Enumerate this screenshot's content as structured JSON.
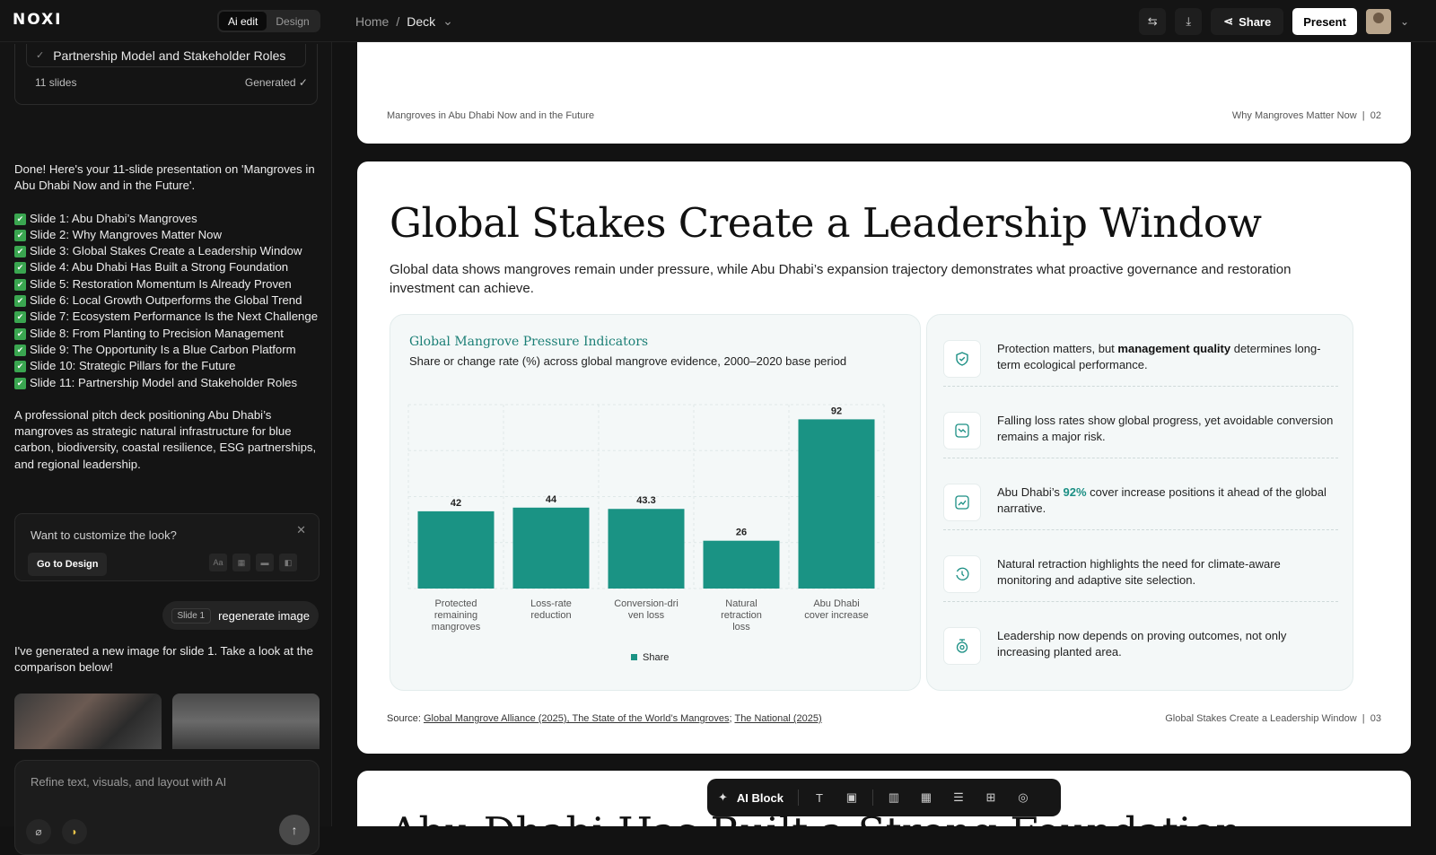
{
  "app": {
    "logo": "NOXI",
    "mode_ai": "Ai edit",
    "mode_design": "Design"
  },
  "breadcrumb": {
    "home": "Home",
    "sep": "/",
    "current": "Deck"
  },
  "toolbar_right": {
    "share": "Share",
    "present": "Present"
  },
  "outline": {
    "last_item": "Partnership Model and Stakeholder Roles",
    "count": "11 slides",
    "status": "Generated ✓"
  },
  "chat": {
    "intro": "Done! Here's your 11-slide presentation on 'Mangroves in Abu Dhabi Now and in the Future'.",
    "slides": [
      "Slide 1: Abu Dhabi’s Mangroves",
      "Slide 2: Why Mangroves Matter Now",
      "Slide 3: Global Stakes Create a Leadership Window",
      "Slide 4: Abu Dhabi Has Built a Strong Foundation",
      "Slide 5: Restoration Momentum Is Already Proven",
      "Slide 6: Local Growth Outperforms the Global Trend",
      "Slide 7: Ecosystem Performance Is the Next Challenge",
      "Slide 8: From Planting to Precision Management",
      "Slide 9: The Opportunity Is a Blue Carbon Platform",
      "Slide 10: Strategic Pillars for the Future",
      "Slide 11: Partnership Model and Stakeholder Roles"
    ],
    "summary": "A professional pitch deck positioning Abu Dhabi’s mangroves as strategic natural infrastructure for blue carbon, biodiversity, coastal resilience, ESG partnerships, and regional leadership.",
    "customize_q": "Want to customize the look?",
    "go_design": "Go to Design",
    "user_tag": "Slide 1",
    "user_msg": "regenerate image",
    "generated": "I've generated a new image for slide 1. Take a look at the comparison below!",
    "input_placeholder": "Refine text, visuals, and layout with AI"
  },
  "slide2": {
    "footer_left": "Mangroves in Abu Dhabi Now and in the Future",
    "footer_right": "Why Mangroves Matter Now",
    "page": "02"
  },
  "slide3": {
    "title": "Global Stakes Create a Leadership Window",
    "subtitle": "Global data shows mangroves remain under pressure, while Abu Dhabi’s expansion trajectory demonstrates what proactive governance and restoration investment can achieve.",
    "bullets": [
      {
        "pre": "Protection matters, but ",
        "bold": "management quality",
        "post": " determines long-term ecological performance.",
        "icon": "shield-check-icon"
      },
      {
        "pre": "Falling loss rates show global progress, yet avoidable conversion remains a major risk.",
        "bold": "",
        "post": "",
        "icon": "trend-down-icon"
      },
      {
        "pre": "Abu Dhabi’s ",
        "bold": "92%",
        "post": " cover increase positions it ahead of the global narrative.",
        "icon": "trend-up-icon"
      },
      {
        "pre": "Natural retraction highlights the need for climate-aware monitoring and adaptive site selection.",
        "bold": "",
        "post": "",
        "icon": "history-icon"
      },
      {
        "pre": "Leadership now depends on proving outcomes, not only increasing planted area.",
        "bold": "",
        "post": "",
        "icon": "target-icon"
      }
    ],
    "source_label": "Source: ",
    "source_1": "Global Mangrove Alliance (2025), The State of the World’s Mangroves",
    "source_2": "The National (2025)",
    "footer_right": "Global Stakes Create a Leadership Window",
    "page": "03"
  },
  "slide4": {
    "title": "Abu Dhabi Has Built a Strong Foundation"
  },
  "bottom_toolbar": {
    "ai_block": "AI Block"
  },
  "chart_data": {
    "type": "bar",
    "title": "Global Mangrove Pressure Indicators",
    "subtitle": "Share or change rate (%) across global mangrove evidence, 2000–2020 base period",
    "categories": [
      "Protected remaining mangroves",
      "Loss-rate reduction",
      "Conversion-driven loss",
      "Natural retraction loss",
      "Abu Dhabi cover increase"
    ],
    "category_lines": [
      [
        "Protected",
        "remaining",
        "mangroves"
      ],
      [
        "Loss-rate",
        "reduction"
      ],
      [
        "Conversion-dri",
        "ven loss"
      ],
      [
        "Natural",
        "retraction",
        "loss"
      ],
      [
        "Abu Dhabi",
        "cover increase"
      ]
    ],
    "series": [
      {
        "name": "Share",
        "values": [
          42,
          44,
          43.3,
          26,
          92
        ]
      }
    ],
    "ylim": [
      0,
      100
    ],
    "grid": true,
    "legend": "bottom",
    "color": "#1a9384"
  }
}
